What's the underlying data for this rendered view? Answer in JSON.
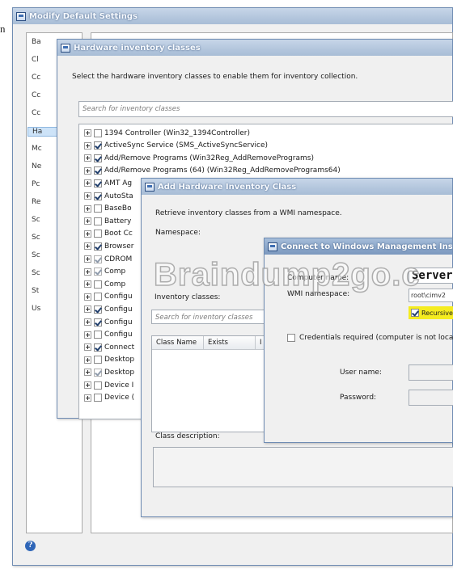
{
  "stray_text": "n",
  "window_modify": {
    "title": "Modify Default Settings",
    "nav_items": [
      "Ba",
      "Cl",
      "Cc",
      "Cc",
      "Cc",
      "Ha",
      "Mc",
      "Ne",
      "Pc",
      "Re",
      "Sc",
      "Sc",
      "Sc",
      "Sc",
      "St",
      "Us"
    ],
    "selected_nav": "Ha",
    "help_icon": "help-icon"
  },
  "window_hw_classes": {
    "title": "Hardware inventory classes",
    "instruction": "Select the hardware inventory classes to enable them for inventory collection.",
    "search_placeholder": "Search for inventory classes",
    "classes": [
      {
        "label": "1394 Controller (Win32_1394Controller)",
        "checked": false
      },
      {
        "label": "ActiveSync Service (SMS_ActiveSyncService)",
        "checked": true
      },
      {
        "label": "Add/Remove Programs (Win32Reg_AddRemovePrograms)",
        "checked": true
      },
      {
        "label": "Add/Remove Programs (64) (Win32Reg_AddRemovePrograms64)",
        "checked": true
      },
      {
        "label": "AMT Ag",
        "checked": true
      },
      {
        "label": "AutoSta",
        "checked": true
      },
      {
        "label": "BaseBo",
        "checked": false
      },
      {
        "label": "Battery",
        "checked": false
      },
      {
        "label": "Boot Cc",
        "checked": false
      },
      {
        "label": "Browser",
        "checked": true
      },
      {
        "label": "CDROM",
        "checked": true,
        "grey": true
      },
      {
        "label": "Comp",
        "checked": true,
        "grey": true
      },
      {
        "label": "Comp",
        "checked": false
      },
      {
        "label": "Configu",
        "checked": false
      },
      {
        "label": "Configu",
        "checked": true
      },
      {
        "label": "Configu",
        "checked": true
      },
      {
        "label": "Configu",
        "checked": false
      },
      {
        "label": "Connect",
        "checked": true
      },
      {
        "label": "Desktop",
        "checked": false
      },
      {
        "label": "Desktop",
        "checked": true,
        "grey": true
      },
      {
        "label": "Device I",
        "checked": false
      },
      {
        "label": "Device (",
        "checked": false
      }
    ]
  },
  "window_add_class": {
    "title": "Add Hardware Inventory Class",
    "retrieve_text": "Retrieve inventory classes from a WMI namespace.",
    "namespace_label": "Namespace:",
    "inventory_label": "Inventory classes:",
    "search_placeholder": "Search for inventory classes",
    "grid_columns": [
      "Class Name",
      "Exists",
      "I"
    ],
    "description_label": "Class description:"
  },
  "window_connect": {
    "title": "Connect to Windows Management Instru",
    "computer_label": "Computer name:",
    "computer_value": "Server",
    "wmi_label": "WMI namespace:",
    "wmi_value": "root\\cimv2",
    "recursive_label": "Recursive",
    "recursive_checked": true,
    "credentials_label": "Credentials required (computer is not loca",
    "credentials_checked": false,
    "username_label": "User name:",
    "password_label": "Password:"
  },
  "watermark": "Braindump2go.c",
  "colors": {
    "title_bar": "#8ba6c9",
    "selection": "#cde3f8",
    "highlight": "#f5ec20"
  }
}
